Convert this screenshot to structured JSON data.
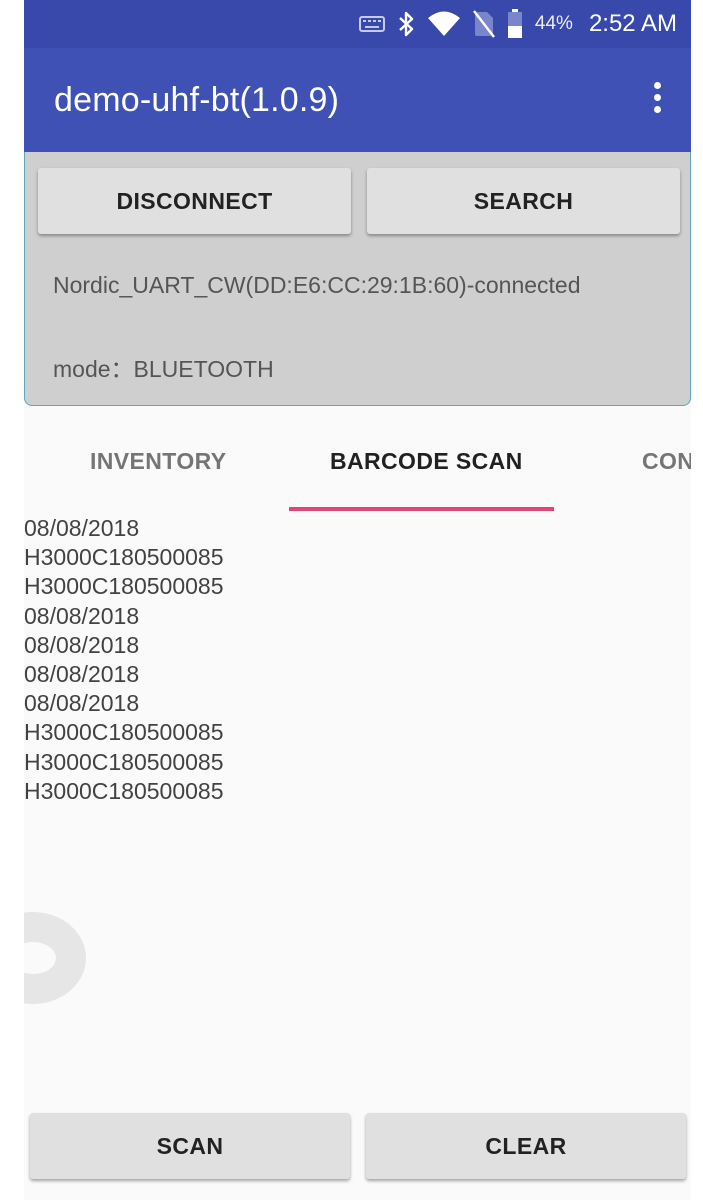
{
  "status_bar": {
    "icons": [
      "keyboard-icon",
      "bluetooth-icon",
      "wifi-icon",
      "no-sim-icon",
      "battery-icon"
    ],
    "battery_percent": "44%",
    "time": "2:52 AM"
  },
  "app_bar": {
    "title": "demo-uhf-bt(1.0.9)",
    "overflow_icon": "more-vert-icon"
  },
  "connection": {
    "disconnect_label": "DISCONNECT",
    "search_label": "SEARCH",
    "status": "Nordic_UART_CW(DD:E6:CC:29:1B:60)-connected",
    "mode": "mode：BLUETOOTH"
  },
  "tabs": [
    {
      "label": "INVENTORY",
      "selected": false
    },
    {
      "label": "BARCODE SCAN",
      "selected": true
    },
    {
      "label": "CON",
      "selected": false
    }
  ],
  "scan_results": [
    "08/08/2018",
    "H3000C180500085",
    "H3000C180500085",
    "08/08/2018",
    "08/08/2018",
    "08/08/2018",
    "08/08/2018",
    "H3000C180500085",
    "H3000C180500085",
    "H3000C180500085"
  ],
  "actions": {
    "scan_label": "SCAN",
    "clear_label": "CLEAR"
  },
  "colors": {
    "status_bar": "#3949ab",
    "app_bar": "#3f51b5",
    "tab_indicator": "#e0457b",
    "panel_bg": "#cfcfcf"
  }
}
